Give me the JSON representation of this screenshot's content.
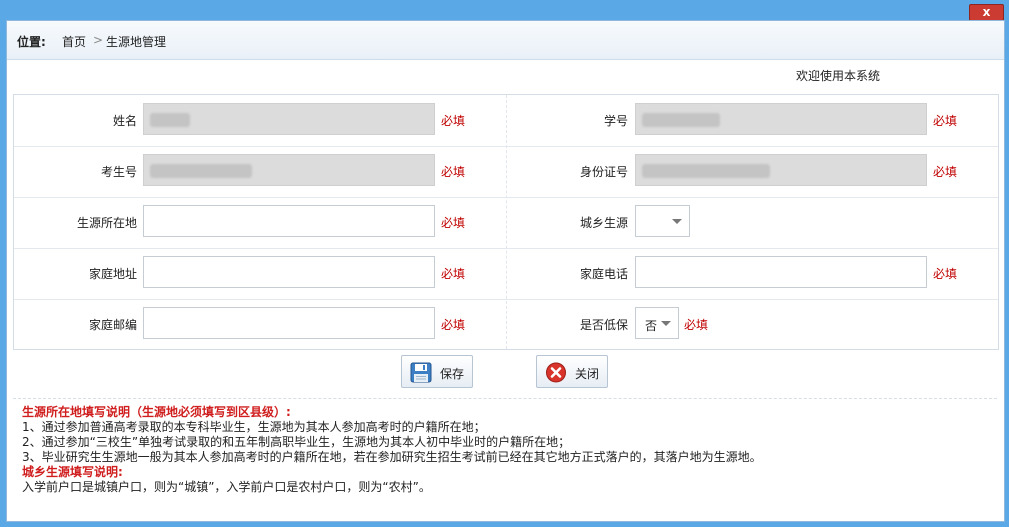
{
  "window": {
    "close_label": "x"
  },
  "breadcrumb": {
    "label": "位置:",
    "home": "首页",
    "separator": ">",
    "current": "生源地管理"
  },
  "welcome": "欢迎使用本系统",
  "form": {
    "required_text": "必填",
    "name_label": "姓名",
    "student_id_label": "学号",
    "exam_no_label": "考生号",
    "id_card_label": "身份证号",
    "origin_label": "生源所在地",
    "urban_rural_label": "城乡生源",
    "home_address_label": "家庭地址",
    "home_phone_label": "家庭电话",
    "postcode_label": "家庭邮编",
    "low_income_label": "是否低保",
    "low_income_value": "否"
  },
  "buttons": {
    "save": "保存",
    "close": "关闭"
  },
  "notes": {
    "origin_title": "生源所在地填写说明（生源地必须填写到区县级）:",
    "origin_items": [
      "1、通过参加普通高考录取的本专科毕业生，生源地为其本人参加高考时的户籍所在地；",
      "2、通过参加“三校生”单独考试录取的和五年制高职毕业生，生源地为其本人初中毕业时的户籍所在地；",
      "3、毕业研究生生源地一般为其本人参加高考时的户籍所在地，若在参加研究生招生考试前已经在其它地方正式落户的，其落户地为生源地。"
    ],
    "urban_title": "城乡生源填写说明:",
    "urban_text": "入学前户口是城镇户口，则为“城镇”，入学前户口是农村户口，则为“农村”。"
  },
  "colors": {
    "required": "#c00000",
    "note_heading": "#d01e1e",
    "frame": "#5aa9e6"
  },
  "icons": {
    "save": "floppy-disk-icon",
    "close": "red-x-circle-icon"
  }
}
